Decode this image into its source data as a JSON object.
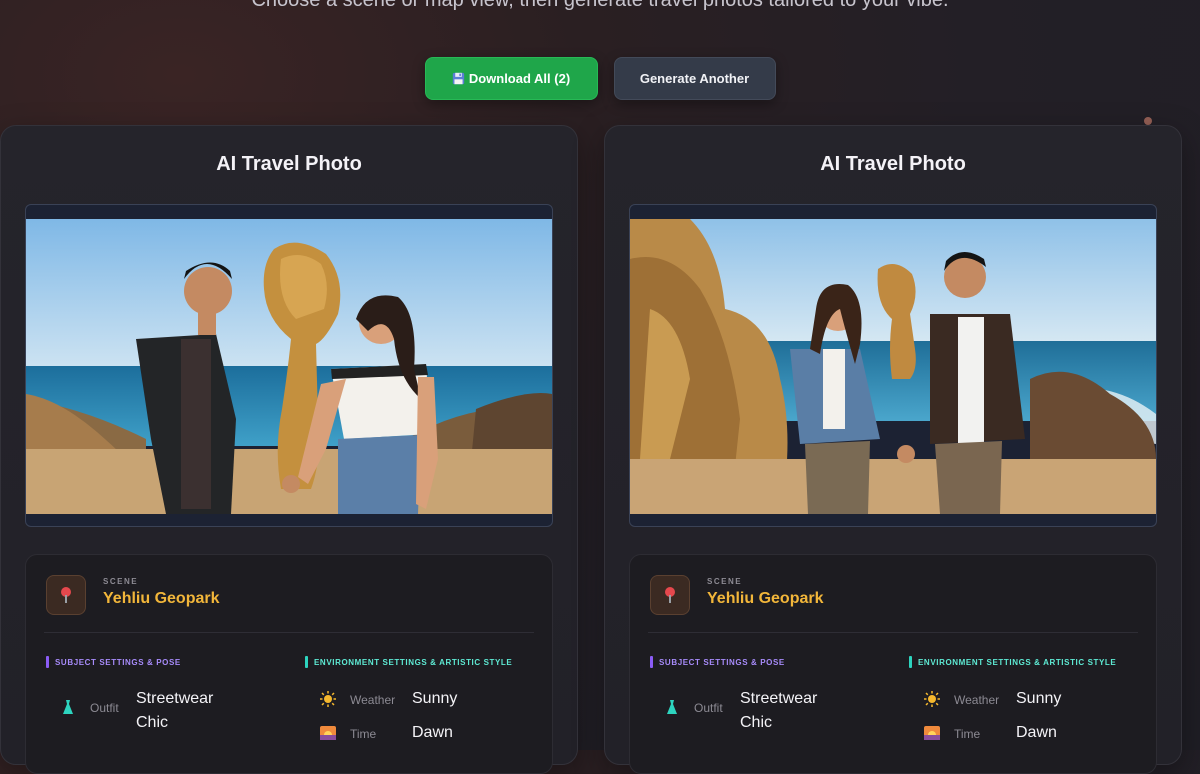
{
  "header": {
    "subtitle": "Choose a scene or map view, then generate travel photos tailored to your vibe."
  },
  "actions": {
    "download_label": "Download All (2)",
    "download_icon": "floppy-disk-icon",
    "generate_label": "Generate Another",
    "download_color": "#1fa64a",
    "generate_color": "#343b49"
  },
  "cards": [
    {
      "title": "AI Travel Photo",
      "scene_label": "SCENE",
      "scene_value": "Yehliu Geopark",
      "subject_heading": "SUBJECT SETTINGS & POSE",
      "environment_heading": "ENVIRONMENT SETTINGS & ARTISTIC STYLE",
      "outfit_key": "Outfit",
      "outfit_value_1": "Streetwear",
      "outfit_value_2": "Chic",
      "weather_key": "Weather",
      "weather_value": "Sunny",
      "time_key": "Time",
      "time_value": "Dawn"
    },
    {
      "title": "AI Travel Photo",
      "scene_label": "SCENE",
      "scene_value": "Yehliu Geopark",
      "subject_heading": "SUBJECT SETTINGS & POSE",
      "environment_heading": "ENVIRONMENT SETTINGS & ARTISTIC STYLE",
      "outfit_key": "Outfit",
      "outfit_value_1": "Streetwear",
      "outfit_value_2": "Chic",
      "weather_key": "Weather",
      "weather_value": "Sunny",
      "time_key": "Time",
      "time_value": "Dawn"
    }
  ],
  "colors": {
    "scene_accent": "#f2b63a",
    "subject_accent": "#a78bfa",
    "environment_accent": "#5eead4"
  }
}
